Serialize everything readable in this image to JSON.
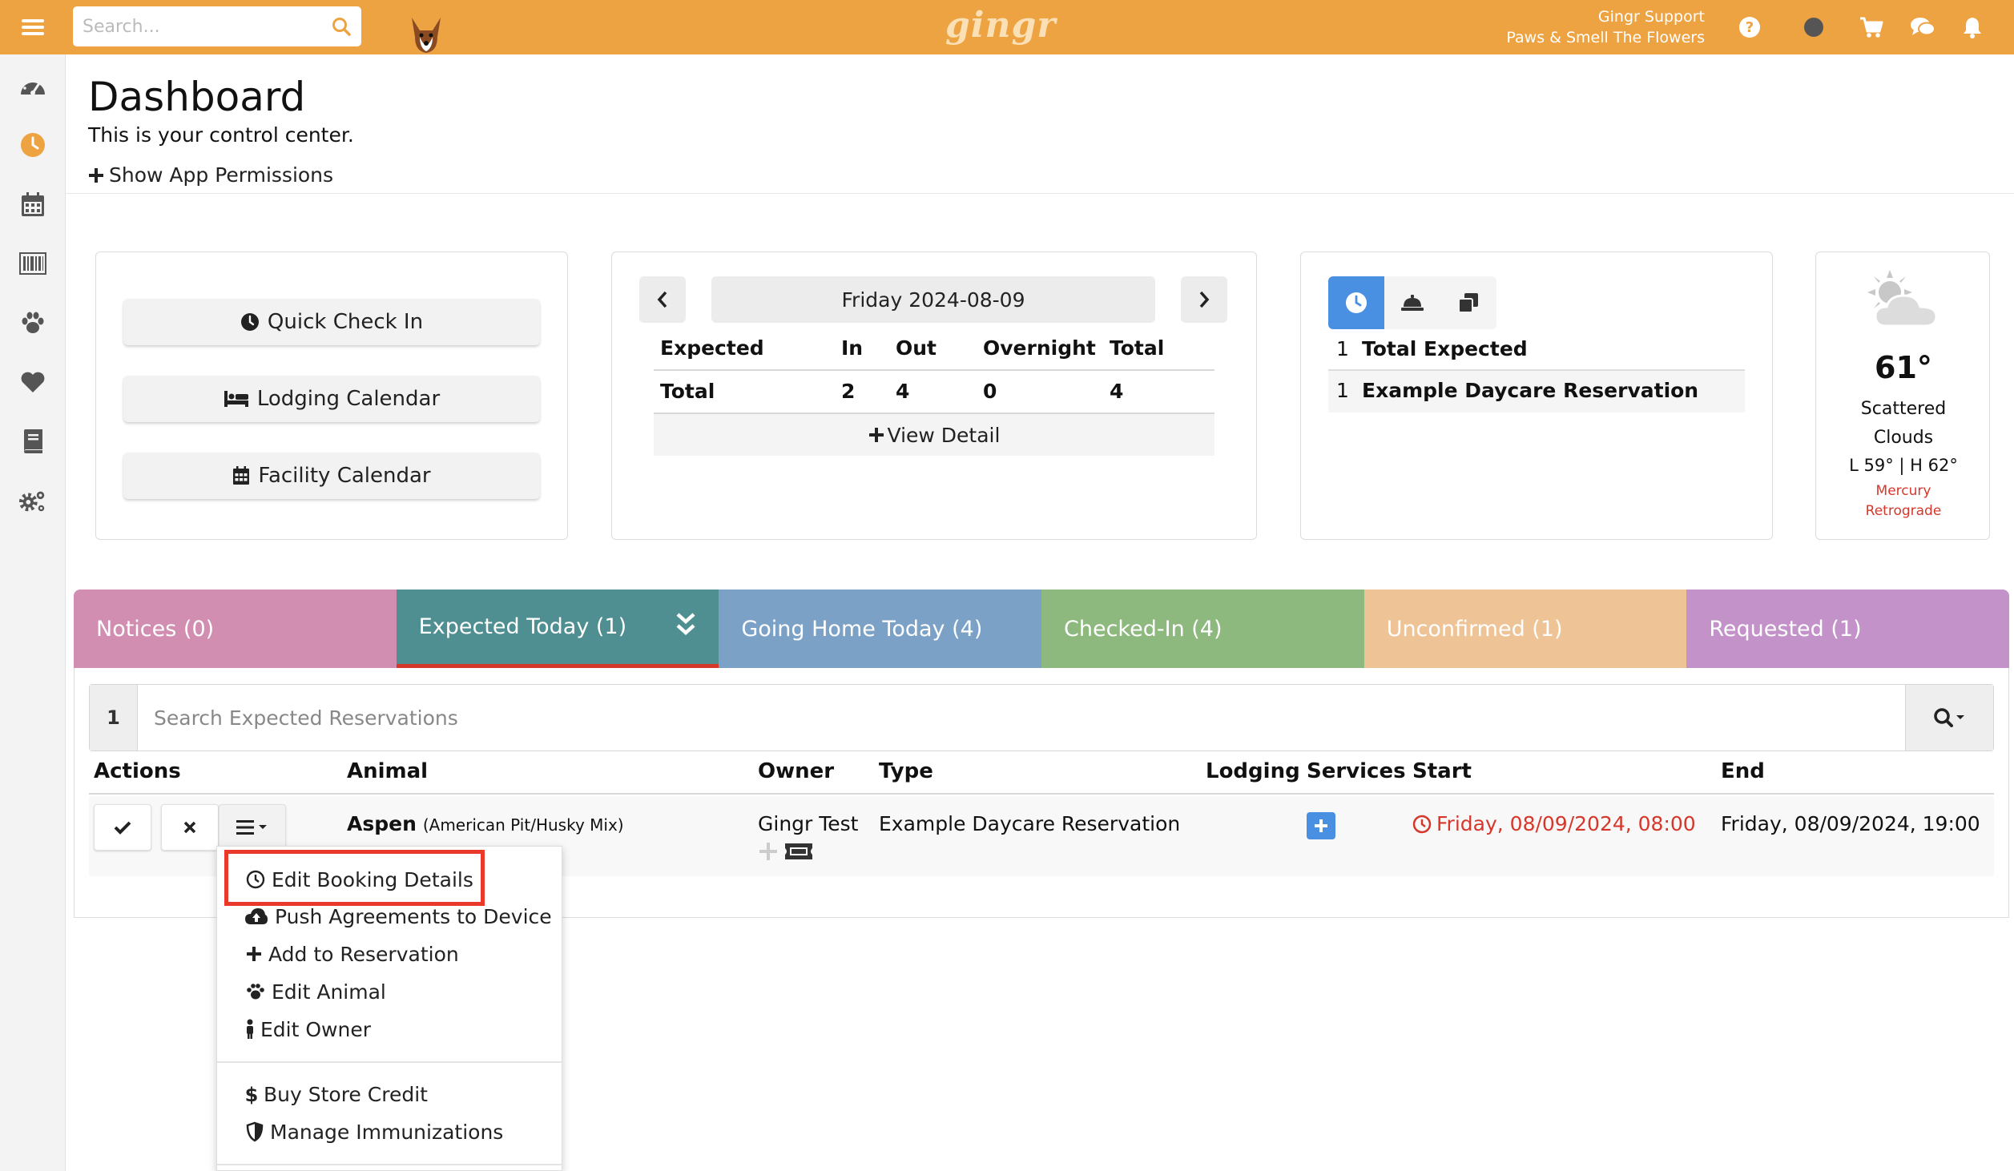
{
  "topbar": {
    "search_placeholder": "Search...",
    "logo": "gingr",
    "user_name": "Gingr Support",
    "location": "Paws & Smell The Flowers"
  },
  "header": {
    "title": "Dashboard",
    "subtitle": "This is your control center.",
    "permissions_link": "Show App Permissions"
  },
  "quick_actions": [
    "Quick Check In",
    "Lodging Calendar",
    "Facility Calendar"
  ],
  "summary": {
    "date": "Friday 2024-08-09",
    "columns": [
      "Expected",
      "In",
      "Out",
      "Overnight",
      "Total"
    ],
    "row": [
      "Total",
      "2",
      "4",
      "0",
      "4"
    ],
    "view_detail": "View Detail"
  },
  "expected_list": [
    {
      "count": "1",
      "label": "Total Expected"
    },
    {
      "count": "1",
      "label": "Example Daycare Reservation"
    }
  ],
  "weather": {
    "temp": "61°",
    "desc": "Scattered Clouds",
    "range": "L 59° | H 62°",
    "note": "Mercury Retrograde"
  },
  "tabs": [
    {
      "label": "Notices (0)",
      "color": "#d28eb1"
    },
    {
      "label": "Expected Today (1)",
      "color": "#4f8f92"
    },
    {
      "label": "Going Home Today (4)",
      "color": "#7ba2c6"
    },
    {
      "label": "Checked-In (4)",
      "color": "#8db97e"
    },
    {
      "label": "Unconfirmed (1)",
      "color": "#eec496"
    },
    {
      "label": "Requested (1)",
      "color": "#c292c9"
    }
  ],
  "reservations": {
    "count": "1",
    "search_placeholder": "Search Expected Reservations",
    "headers": {
      "actions": "Actions",
      "animal": "Animal",
      "owner": "Owner",
      "type": "Type",
      "lodging": "Lodging",
      "services": "Services",
      "start": "Start",
      "end": "End"
    },
    "row": {
      "animal_name": "Aspen",
      "breed": "(American Pit/Husky Mix)",
      "owner": "Gingr Test",
      "type": "Example Daycare Reservation",
      "start": "Friday, 08/09/2024, 08:00",
      "end": "Friday, 08/09/2024, 19:00"
    }
  },
  "menu": {
    "items": [
      "Edit Booking Details",
      "Push Agreements to Device",
      "Add to Reservation",
      "Edit Animal",
      "Edit Owner",
      "Buy Store Credit",
      "Manage Immunizations"
    ]
  },
  "colors": {
    "topbar": "#eda342",
    "highlight": "#e8392a",
    "start_red": "#d6372b",
    "service_blue": "#4a90e2"
  }
}
